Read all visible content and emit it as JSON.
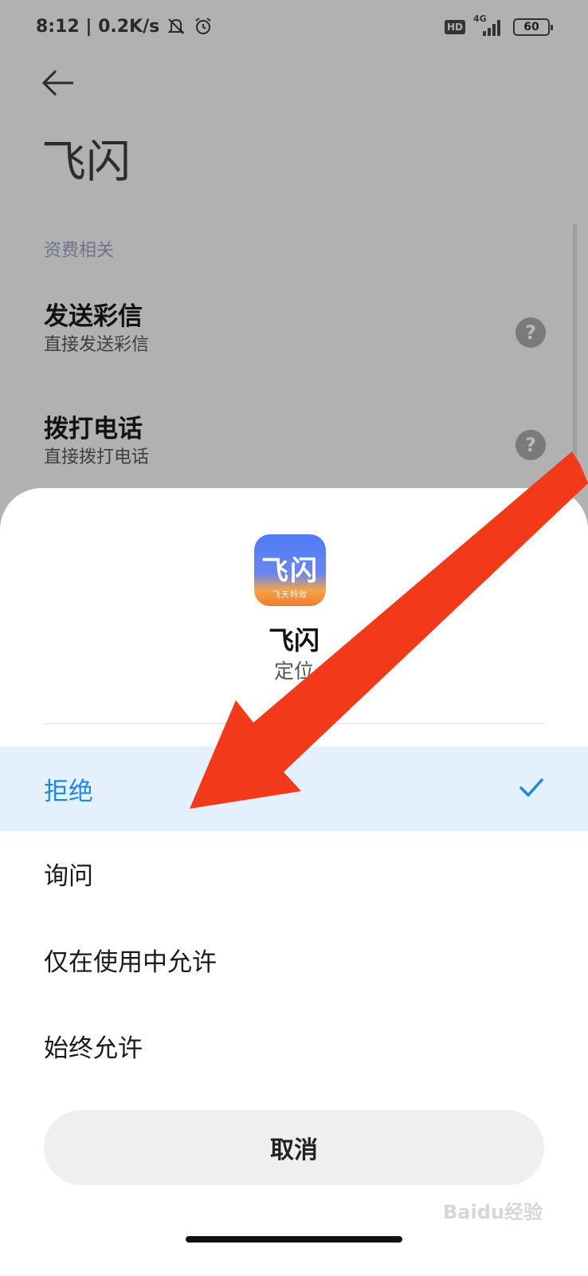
{
  "status_bar": {
    "time_and_speed": "8:12 | 0.2K/s",
    "hd": "HD",
    "network": "4G",
    "battery": "60"
  },
  "page": {
    "title": "飞闪",
    "section": "资费相关",
    "items": [
      {
        "title": "发送彩信",
        "subtitle": "直接发送彩信"
      },
      {
        "title": "拨打电话",
        "subtitle": "直接拨打电话"
      }
    ]
  },
  "sheet": {
    "app_icon_text": "飞闪",
    "app_icon_subtext": "飞天特效",
    "app_name": "飞闪",
    "permission": "定位",
    "options": [
      {
        "label": "拒绝",
        "selected": true
      },
      {
        "label": "询问",
        "selected": false
      },
      {
        "label": "仅在使用中允许",
        "selected": false
      },
      {
        "label": "始终允许",
        "selected": false
      }
    ],
    "cancel": "取消"
  },
  "watermark": "Baidu经验",
  "colors": {
    "accent": "#1e88e5",
    "selected_bg": "#e4f0fc",
    "annotation": "#f2391a"
  }
}
